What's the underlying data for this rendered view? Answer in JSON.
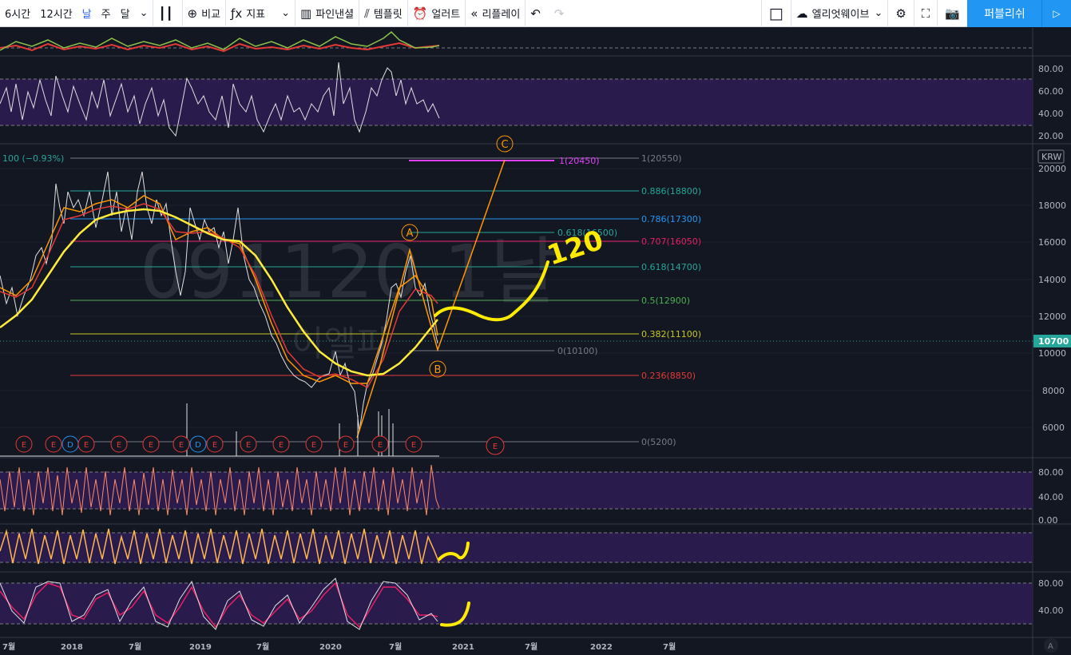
{
  "toolbar": {
    "intervals": [
      "6시간",
      "12시간",
      "날",
      "주",
      "달"
    ],
    "active_interval": "날",
    "compare": "비교",
    "indicators": "지표",
    "pine": "파인낸셜",
    "templates": "템플릿",
    "alert": "얼러트",
    "replay": "리플레이",
    "layout_name": "엘리엇웨이브",
    "publish": "퍼블리쉬"
  },
  "price_axis": {
    "currency": "KRW",
    "ticks": [
      "20000",
      "18000",
      "16000",
      "14000",
      "12000",
      "10000",
      "8000",
      "6000"
    ],
    "last_price": "10700"
  },
  "indicator_axes": {
    "rsi": [
      "80.00",
      "60.00",
      "40.00",
      "20.00"
    ],
    "osc1": [
      "80.00",
      "40.00",
      "0.00"
    ],
    "osc3": [
      "80.00",
      "40.00"
    ]
  },
  "time_axis": [
    "7월",
    "2018",
    "7월",
    "2019",
    "7월",
    "2020",
    "7월",
    "2021",
    "7월",
    "2022",
    "7월"
  ],
  "legend_change": "100 (−0.93%)",
  "watermark": {
    "symbol": "091120   1날",
    "name": "이엘피"
  },
  "fib_right": [
    "1(20550)",
    "0.886(18800)",
    "0.786(17300)",
    "0.707(16050)",
    "0.618(14700)",
    "0.5(12900)",
    "0.382(11100)",
    "0.236(8850)",
    "0(5200)"
  ],
  "fib_proj": [
    "1(20450)",
    "0.618(16500)",
    "0(10100)"
  ],
  "wave_labels": [
    "A",
    "B",
    "C"
  ],
  "annotation": "120",
  "event_markers": [
    "E",
    "E",
    "D",
    "E",
    "E",
    "E",
    "E",
    "D",
    "E",
    "E",
    "E",
    "E",
    "E",
    "E",
    "E",
    "E"
  ],
  "colors": {
    "background": "#131722",
    "accent": "#2196f3",
    "annotation": "#ffeb00",
    "wave": "#ff9800",
    "indicator_band": "#2a1b4d"
  }
}
